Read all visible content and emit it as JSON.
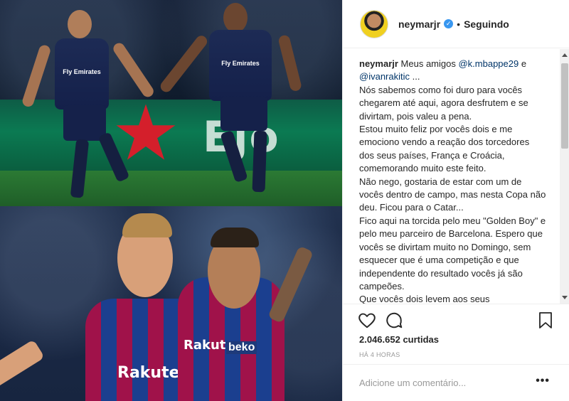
{
  "post": {
    "username": "neymarjr",
    "verified_glyph": "✓",
    "separator": "•",
    "follow_status": "Seguindo",
    "caption": {
      "author": "neymarjr",
      "intro": "Meus amigos",
      "mention1": "@k.mbappe29",
      "conj": "e",
      "mention2": "@ivanrakitic",
      "ellipsis": "...",
      "lines": [
        "Nós sabemos como foi duro para vocês chegarem até aqui, agora desfrutem e se divirtam, pois valeu a pena.",
        "Estou muito feliz por vocês dois e me emociono vendo a reação dos torcedores dos seus países, França e Croácia, comemorando muito este feito.",
        "Não nego, gostaria de estar com um de vocês dentro de campo, mas nesta Copa não deu. Ficou para o Catar...",
        "Fico aqui na torcida pelo meu \"Golden Boy\" e pelo meu parceiro de Barcelona. Espero que vocês se divirtam muito no Domingo, sem esquecer que é uma competição e que independente do resultado vocês já são campeões.",
        "Que vocês dois levem aos seus companheiros de elenco meu desejo de sucesso e muita alegria no futebol."
      ]
    },
    "likes": "2.046.652 curtidas",
    "time_ago": "HÁ 4 HORAS",
    "comment_placeholder": "Adicione um comentário...",
    "more_glyph": "•••",
    "icons": {
      "like": "heart-icon",
      "comment": "comment-icon",
      "save": "bookmark-icon",
      "verified": "verified-badge-icon",
      "more": "more-options-icon"
    }
  },
  "photo": {
    "top_sponsor_1": "Fly Emirates",
    "top_sponsor_2": "Fly Emirates",
    "adboard_text": "Ejo",
    "bottom_sponsor_1": "Rakuten",
    "bottom_sponsor_2": "beko",
    "bottom_sponsor_3": "Rakuten"
  },
  "colors": {
    "mention": "#003569",
    "muted": "#999999",
    "verified": "#3897f0",
    "border": "#efefef"
  }
}
